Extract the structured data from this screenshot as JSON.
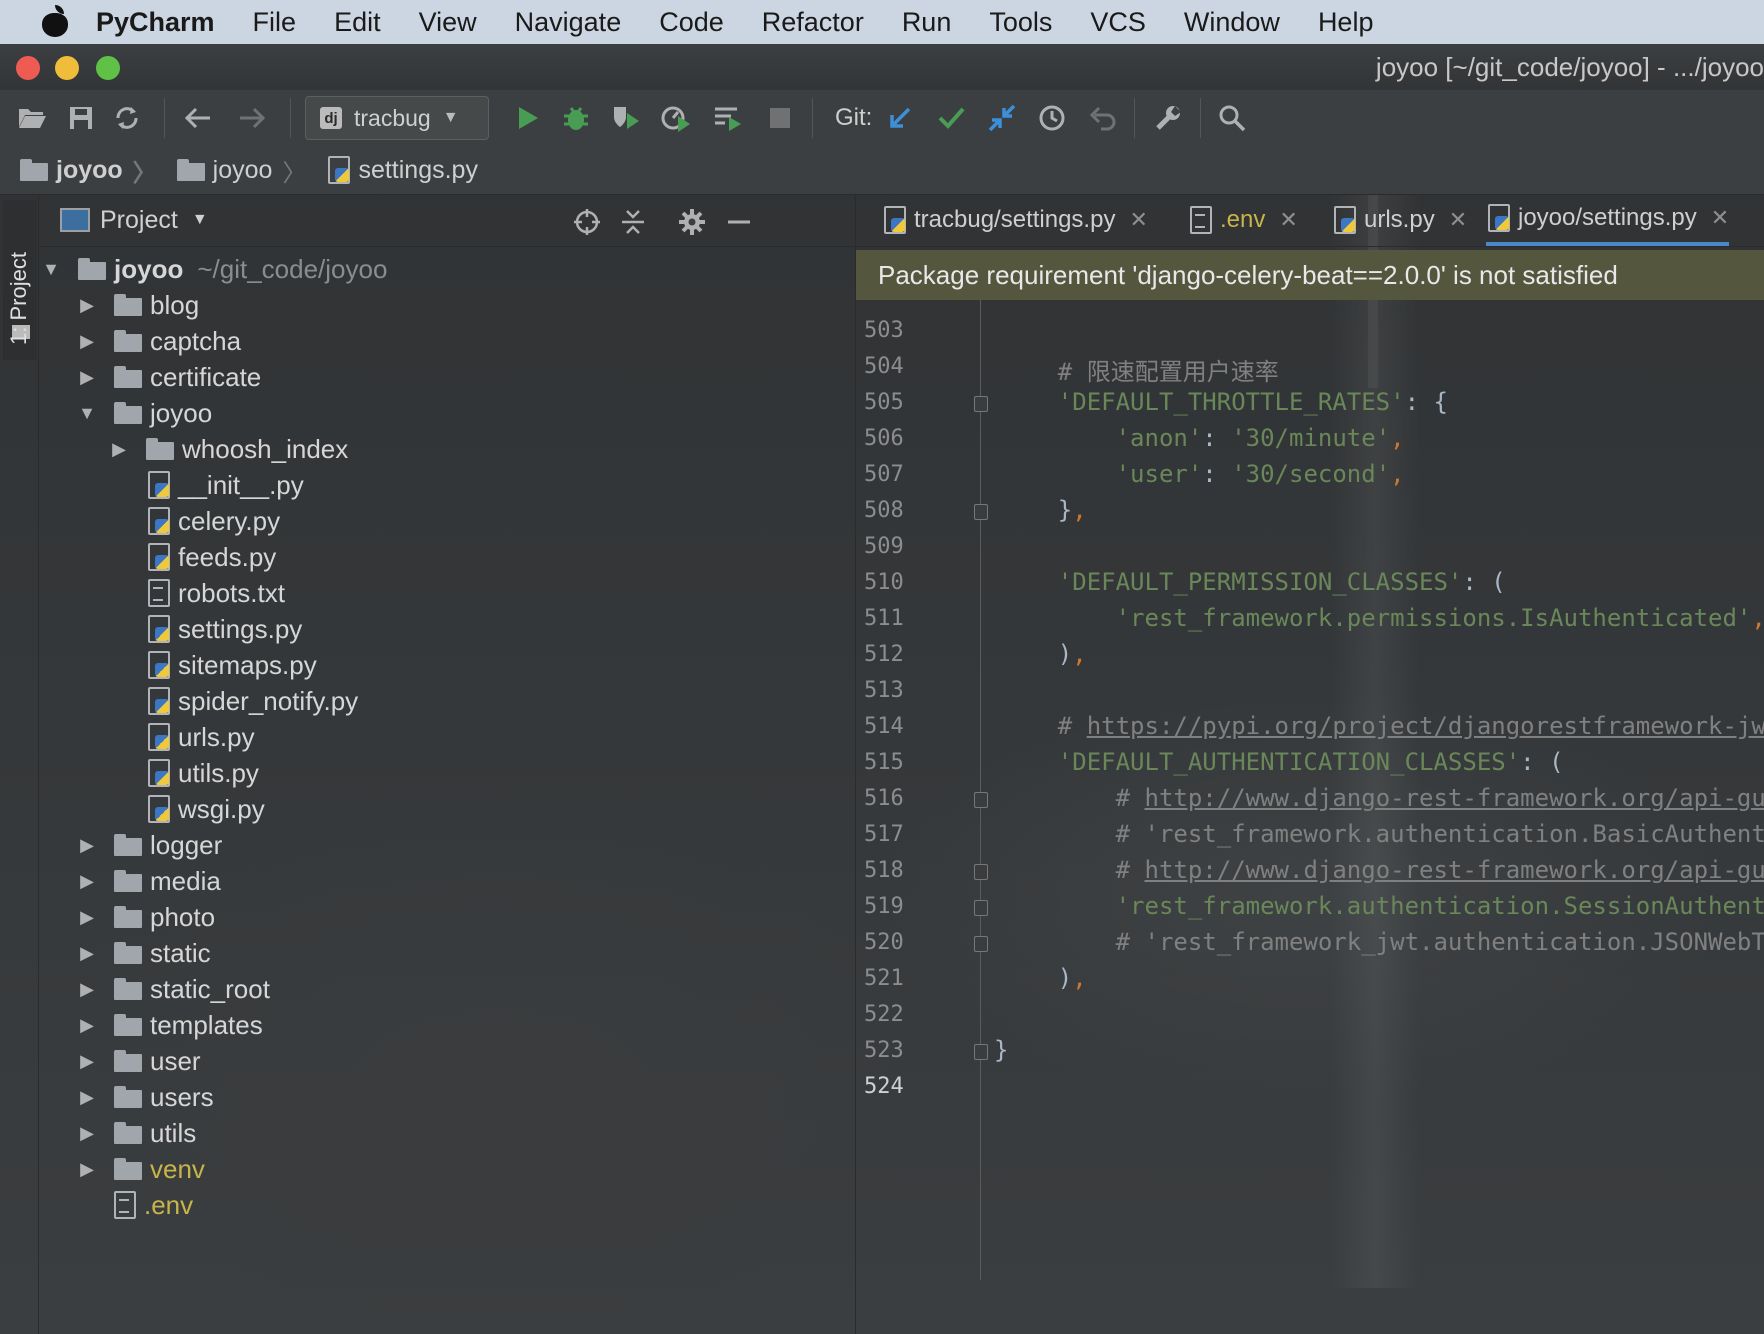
{
  "menubar": {
    "app": "PyCharm",
    "items": [
      "File",
      "Edit",
      "View",
      "Navigate",
      "Code",
      "Refactor",
      "Run",
      "Tools",
      "VCS",
      "Window",
      "Help"
    ]
  },
  "window": {
    "title": "joyoo [~/git_code/joyoo] - .../joyoo"
  },
  "toolbar": {
    "run_config": "tracbug",
    "run_config_badge": "dj",
    "git_label": "Git:",
    "icons": [
      "open-folder-icon",
      "save-icon",
      "sync-icon",
      "back-icon",
      "forward-icon",
      "run-icon",
      "debug-icon",
      "coverage-icon",
      "profile-icon",
      "concurrency-icon",
      "stop-icon",
      "git-update-icon",
      "git-commit-icon",
      "git-compare-icon",
      "history-icon",
      "revert-icon",
      "wrench-icon",
      "search-icon"
    ]
  },
  "breadcrumb": [
    "joyoo",
    "joyoo",
    "settings.py"
  ],
  "project_panel": {
    "title": "Project",
    "root": {
      "name": "joyoo",
      "path": "~/git_code/joyoo"
    },
    "items": [
      {
        "name": "blog",
        "type": "folder",
        "depth": 1,
        "expanded": false
      },
      {
        "name": "captcha",
        "type": "folder",
        "depth": 1,
        "expanded": false
      },
      {
        "name": "certificate",
        "type": "folder",
        "depth": 1,
        "expanded": false
      },
      {
        "name": "joyoo",
        "type": "folder",
        "depth": 1,
        "expanded": true
      },
      {
        "name": "whoosh_index",
        "type": "folder",
        "depth": 2,
        "expanded": false
      },
      {
        "name": "__init__.py",
        "type": "py",
        "depth": 2
      },
      {
        "name": "celery.py",
        "type": "py",
        "depth": 2
      },
      {
        "name": "feeds.py",
        "type": "py",
        "depth": 2
      },
      {
        "name": "robots.txt",
        "type": "txt",
        "depth": 2
      },
      {
        "name": "settings.py",
        "type": "py",
        "depth": 2
      },
      {
        "name": "sitemaps.py",
        "type": "py",
        "depth": 2
      },
      {
        "name": "spider_notify.py",
        "type": "py",
        "depth": 2
      },
      {
        "name": "urls.py",
        "type": "py",
        "depth": 2
      },
      {
        "name": "utils.py",
        "type": "py",
        "depth": 2
      },
      {
        "name": "wsgi.py",
        "type": "py",
        "depth": 2
      },
      {
        "name": "logger",
        "type": "folder",
        "depth": 1,
        "expanded": false
      },
      {
        "name": "media",
        "type": "folder",
        "depth": 1,
        "expanded": false
      },
      {
        "name": "photo",
        "type": "folder",
        "depth": 1,
        "expanded": false
      },
      {
        "name": "static",
        "type": "folder",
        "depth": 1,
        "expanded": false
      },
      {
        "name": "static_root",
        "type": "folder",
        "depth": 1,
        "expanded": false
      },
      {
        "name": "templates",
        "type": "folder",
        "depth": 1,
        "expanded": false
      },
      {
        "name": "user",
        "type": "folder",
        "depth": 1,
        "expanded": false
      },
      {
        "name": "users",
        "type": "folder",
        "depth": 1,
        "expanded": false
      },
      {
        "name": "utils",
        "type": "folder",
        "depth": 1,
        "expanded": false
      },
      {
        "name": "venv",
        "type": "folder",
        "depth": 1,
        "expanded": false,
        "highlight": true
      },
      {
        "name": ".env",
        "type": "txt",
        "depth": 1,
        "highlight": true
      }
    ]
  },
  "side_strip": {
    "label": "1: Project"
  },
  "tabs": [
    {
      "label": "tracbug/settings.py",
      "type": "py",
      "active": false
    },
    {
      "label": ".env",
      "type": "txt",
      "active": false
    },
    {
      "label": "urls.py",
      "type": "py",
      "active": false
    },
    {
      "label": "joyoo/settings.py",
      "type": "py",
      "active": true
    }
  ],
  "banner": {
    "text": "Package requirement 'django-celery-beat==2.0.0' is not satisfied"
  },
  "editor": {
    "current_line": "524",
    "lines": [
      {
        "n": "503",
        "t": []
      },
      {
        "n": "504",
        "t": [
          {
            "c": "c",
            "v": "    # 限速配置用户速率"
          }
        ]
      },
      {
        "n": "505",
        "t": [
          {
            "c": "s",
            "v": "    'DEFAULT_THROTTLE_RATES'"
          },
          {
            "c": "n",
            "v": ": {"
          }
        ]
      },
      {
        "n": "506",
        "t": [
          {
            "c": "s",
            "v": "        'anon'"
          },
          {
            "c": "n",
            "v": ": "
          },
          {
            "c": "s",
            "v": "'30/minute'"
          },
          {
            "c": "p",
            "v": ","
          }
        ]
      },
      {
        "n": "507",
        "t": [
          {
            "c": "s",
            "v": "        'user'"
          },
          {
            "c": "n",
            "v": ": "
          },
          {
            "c": "s",
            "v": "'30/second'"
          },
          {
            "c": "p",
            "v": ","
          }
        ]
      },
      {
        "n": "508",
        "t": [
          {
            "c": "n",
            "v": "    }"
          },
          {
            "c": "p",
            "v": ","
          }
        ]
      },
      {
        "n": "509",
        "t": []
      },
      {
        "n": "510",
        "t": [
          {
            "c": "s",
            "v": "    'DEFAULT_PERMISSION_CLASSES'"
          },
          {
            "c": "n",
            "v": ": ("
          }
        ]
      },
      {
        "n": "511",
        "t": [
          {
            "c": "s",
            "v": "        'rest_framework.permissions.IsAuthenticated'"
          },
          {
            "c": "p",
            "v": ","
          }
        ]
      },
      {
        "n": "512",
        "t": [
          {
            "c": "n",
            "v": "    )"
          },
          {
            "c": "p",
            "v": ","
          }
        ]
      },
      {
        "n": "513",
        "t": []
      },
      {
        "n": "514",
        "t": [
          {
            "c": "c",
            "v": "    # "
          },
          {
            "c": "u",
            "v": "https://pypi.org/project/djangorestframework-jwt/"
          }
        ]
      },
      {
        "n": "515",
        "t": [
          {
            "c": "s",
            "v": "    'DEFAULT_AUTHENTICATION_CLASSES'"
          },
          {
            "c": "n",
            "v": ": ("
          }
        ]
      },
      {
        "n": "516",
        "t": [
          {
            "c": "c",
            "v": "        # "
          },
          {
            "c": "u",
            "v": "http://www.django-rest-framework.org/api-guid"
          }
        ]
      },
      {
        "n": "517",
        "t": [
          {
            "c": "c",
            "v": "        # 'rest_framework.authentication.BasicAuthentic"
          }
        ]
      },
      {
        "n": "518",
        "t": [
          {
            "c": "c",
            "v": "        # "
          },
          {
            "c": "u",
            "v": "http://www.django-rest-framework.org/api-guid"
          }
        ]
      },
      {
        "n": "519",
        "t": [
          {
            "c": "s",
            "v": "        'rest_framework.authentication.SessionAuthentic"
          }
        ]
      },
      {
        "n": "520",
        "t": [
          {
            "c": "c",
            "v": "        # 'rest_framework_jwt.authentication.JSONWebTok"
          }
        ]
      },
      {
        "n": "521",
        "t": [
          {
            "c": "n",
            "v": "    )"
          },
          {
            "c": "p",
            "v": ","
          }
        ]
      },
      {
        "n": "522",
        "t": []
      },
      {
        "n": "523",
        "t": [
          {
            "c": "n",
            "v": "}"
          }
        ]
      },
      {
        "n": "524",
        "t": []
      }
    ]
  },
  "colors": {
    "menubar": "#cbd6e2",
    "traffic_red": "#ee5b53",
    "traffic_yellow": "#f0bd3b",
    "traffic_green": "#5fc247",
    "banner": "#54573e",
    "active_tab_underline": "#4a88c7",
    "string": "#6a8759",
    "comment": "#808080",
    "punct": "#cc7832"
  }
}
